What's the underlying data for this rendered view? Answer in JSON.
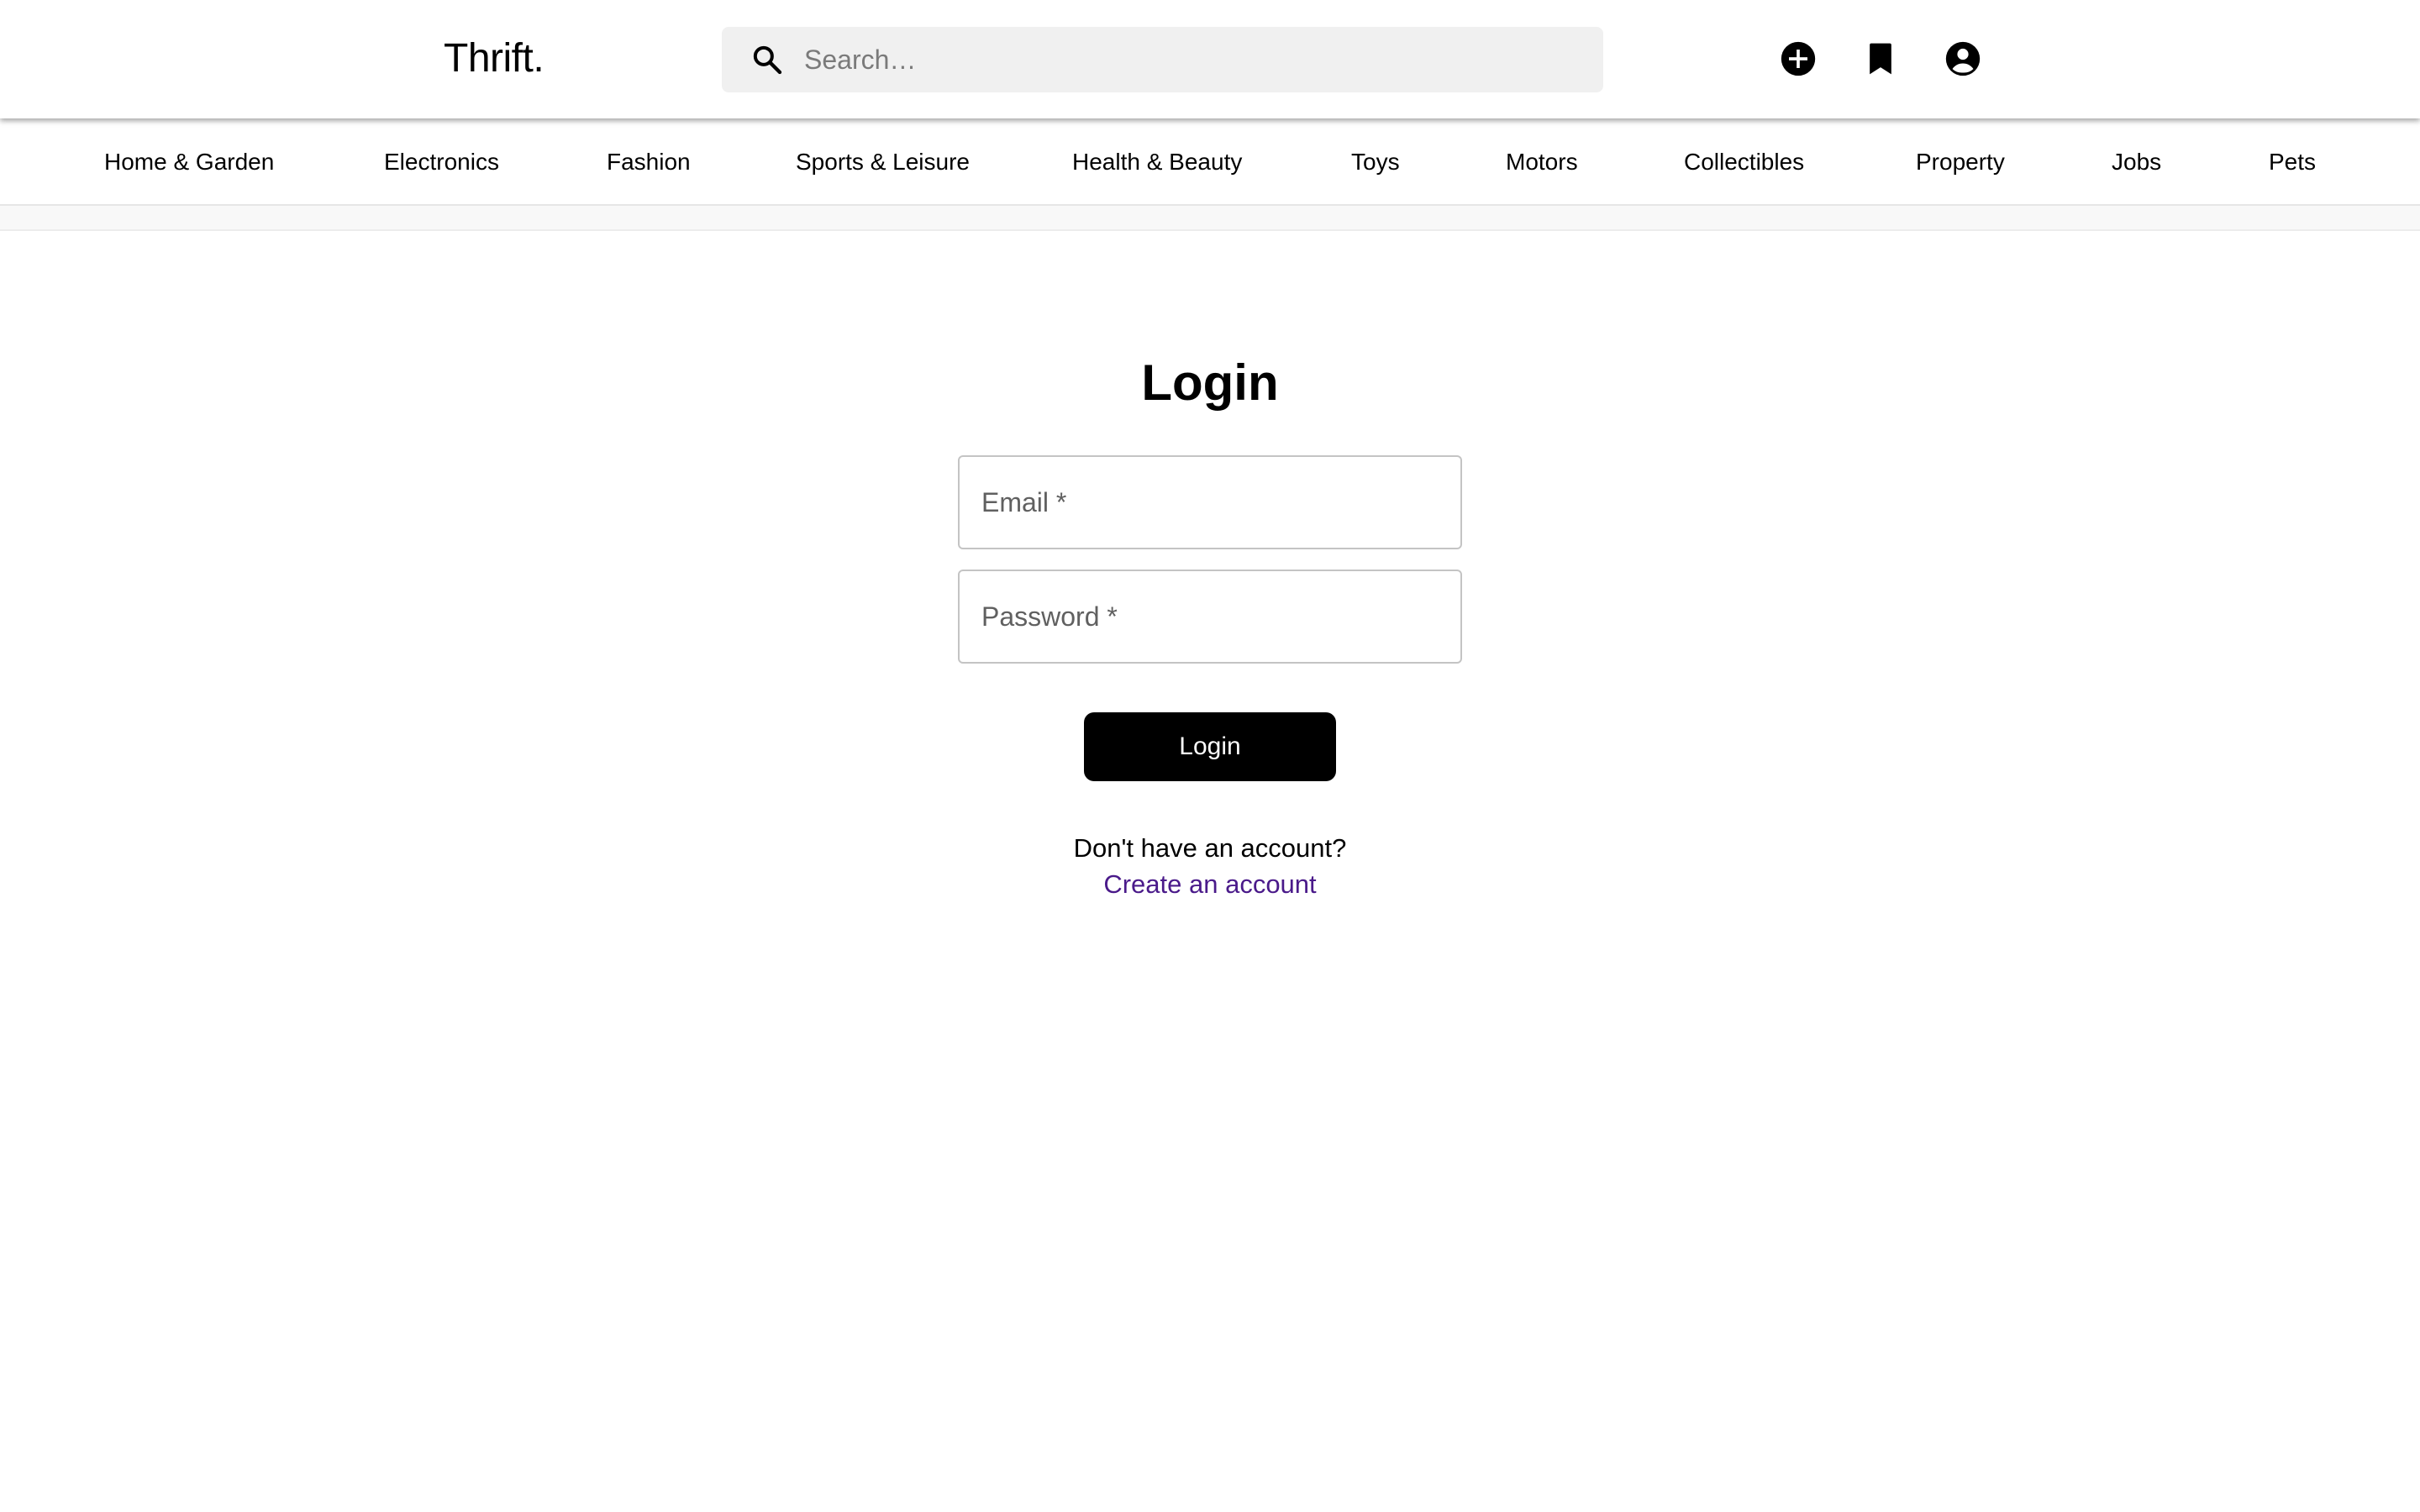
{
  "header": {
    "brand": "Thrift.",
    "search": {
      "placeholder": "Search…",
      "icon": "search-icon"
    },
    "actions": [
      {
        "icon": "add-circle-icon"
      },
      {
        "icon": "bookmark-icon"
      },
      {
        "icon": "account-circle-icon"
      }
    ]
  },
  "categories": [
    "Home & Garden",
    "Electronics",
    "Fashion",
    "Sports & Leisure",
    "Health & Beauty",
    "Toys",
    "Motors",
    "Collectibles",
    "Property",
    "Jobs",
    "Pets"
  ],
  "login": {
    "title": "Login",
    "email_placeholder": "Email *",
    "password_placeholder": "Password *",
    "submit_label": "Login",
    "signup_prompt": "Don't have an account?",
    "signup_link": "Create an account"
  },
  "colors": {
    "primary": "#000000",
    "link": "#4a1a8a",
    "search_bg": "#f0f0f0"
  }
}
